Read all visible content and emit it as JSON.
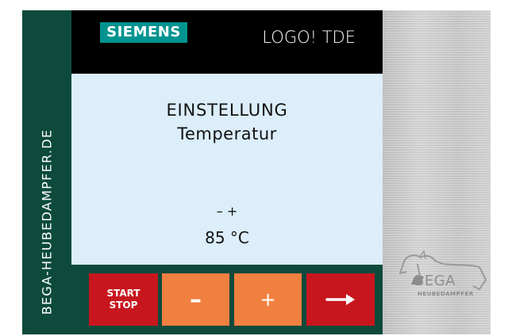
{
  "sidebar": {
    "text": "BEGA-HEUBEDAMPFER.DE"
  },
  "header": {
    "brand": "SIEMENS",
    "model": "LOGO! TDE"
  },
  "screen": {
    "title": "EINSTELLUNG",
    "subtitle": "Temperatur",
    "hint": "– +",
    "value": "85 °C"
  },
  "buttons": {
    "start_line1": "START",
    "start_line2": "STOP",
    "minus": "–",
    "plus": "+",
    "next_icon": "arrow-right-icon"
  },
  "bega": {
    "name": "BEGA",
    "subtitle": "HEUBEDAMPFER"
  },
  "colors": {
    "sidebar_bg": "#0d4a3c",
    "header_bg": "#000000",
    "siemens_teal": "#00938f",
    "screen_bg": "#dbeef9",
    "button_red": "#c8161e",
    "button_orange": "#f08040"
  }
}
